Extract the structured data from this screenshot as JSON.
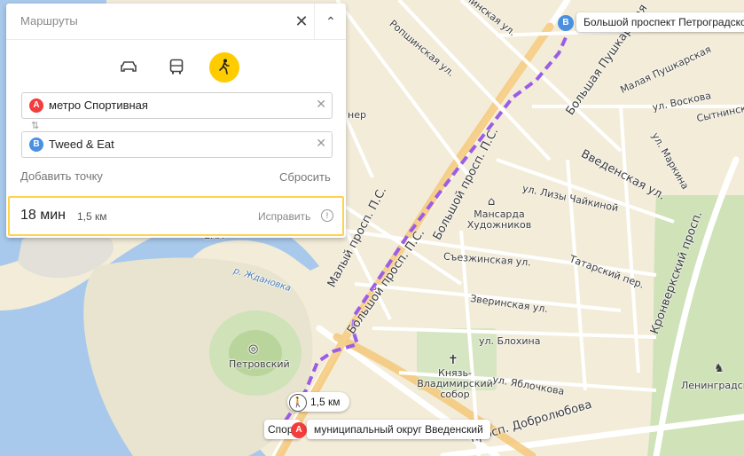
{
  "panel": {
    "title": "Маршруты",
    "modes": [
      {
        "name": "car-icon",
        "active": false
      },
      {
        "name": "bus-icon",
        "active": false
      },
      {
        "name": "pedestrian-icon",
        "active": true
      }
    ],
    "point_a": {
      "marker": "A",
      "value": "метро Спортивная",
      "color": "#f43c3c"
    },
    "point_b": {
      "marker": "B",
      "value": "Tweed & Eat",
      "color": "#4a90e2"
    },
    "add_point": "Добавить точку",
    "reset": "Сбросить",
    "result": {
      "time": "18 мин",
      "distance": "1,5 км",
      "fix": "Исправить"
    }
  },
  "route": {
    "color": "#9b5de5",
    "distance_label": "1,5 км",
    "start_label": "муниципальный округ Введенский",
    "start_marker": "A",
    "end_label": "Большой проспект Петроградской",
    "end_marker": "B",
    "start_prefix": "Спор"
  },
  "map_labels": {
    "bolshaya_pushkarskaya": "Большая Пушкарская",
    "malaya_pushkarskaya": "Малая Пушкарская",
    "kolpinskaya": "Колпинская ул.",
    "ropshinskaya": "Ропшинская ул.",
    "vvedenskaya": "Введенская ул.",
    "voskova": "ул. Воскова",
    "sytninskaya": "Сытнинская",
    "markina": "ул. Маркина",
    "chaikinoy": "ул. Лизы Чайкиной",
    "mansarda": "Мансарда Художников",
    "malyy_prosp": "Малый просп. П.С.",
    "bolshoy_prosp": "Большой просп. П.С.",
    "bolshoy_prosp_top": "Большой просп. П.С.",
    "sezzhinskaya": "Съезжинская ул.",
    "tatarskiy": "Татарский пер.",
    "zverinskaya": "Зверинская ул.",
    "blokhina": "ул. Блохина",
    "yablochkova": "ул. Яблочкова",
    "kronverkskiy": "Кронверкский просп.",
    "knyaz": "Князь-Владимирский собор",
    "leningradskiy": "Ленинградский з",
    "petrovskiy": "Петровский",
    "zhdanovka": "р. Ждановка",
    "dobrolyubova": "просп. Добролюбова",
    "ner": "нер",
    "ekh": "ЕКЛ"
  }
}
